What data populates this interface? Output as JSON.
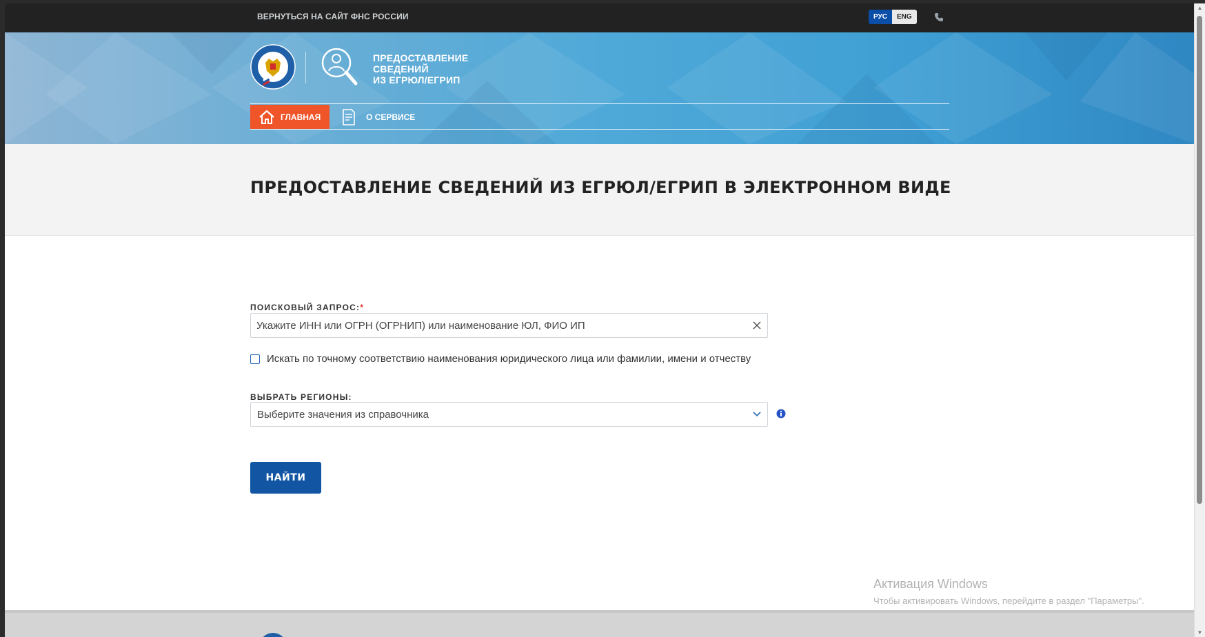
{
  "topbar": {
    "back_link": "ВЕРНУТЬСЯ НА САЙТ ФНС РОССИИ",
    "lang_ru": "РУС",
    "lang_en": "ENG"
  },
  "header": {
    "service_title_line1": "ПРЕДОСТАВЛЕНИЕ",
    "service_title_line2": "СВЕДЕНИЙ",
    "service_title_line3": "ИЗ ЕГРЮЛ/ЕГРИП",
    "nav_home": "ГЛАВНАЯ",
    "nav_about": "О СЕРВИСЕ"
  },
  "page": {
    "title": "ПРЕДОСТАВЛЕНИЕ СВЕДЕНИЙ ИЗ ЕГРЮЛ/ЕГРИП В ЭЛЕКТРОННОМ ВИДЕ"
  },
  "form": {
    "search_label": "ПОИСКОВЫЙ ЗАПРОС:",
    "required_mark": "*",
    "search_placeholder": "Укажите ИНН или ОГРН (ОГРНИП) или наименование ЮЛ, ФИО ИП",
    "exact_match_label": "Искать по точному соответствию наименования юридического лица или фамилии, имени и отчеству",
    "region_label": "ВЫБРАТЬ РЕГИОНЫ:",
    "region_placeholder": "Выберите значения из справочника",
    "find_button": "НАЙТИ"
  },
  "watermark": {
    "title": "Активация Windows",
    "subtitle": "Чтобы активировать Windows, перейдите в раздел \"Параметры\"."
  },
  "colors": {
    "accent_orange": "#f0552a",
    "primary_blue": "#1256a3",
    "lang_active": "#0a4ea8"
  },
  "icons": [
    "phone-icon",
    "emblem-logo",
    "service-icon",
    "home-icon",
    "document-icon",
    "clear-icon",
    "chevron-down-icon",
    "info-icon"
  ]
}
